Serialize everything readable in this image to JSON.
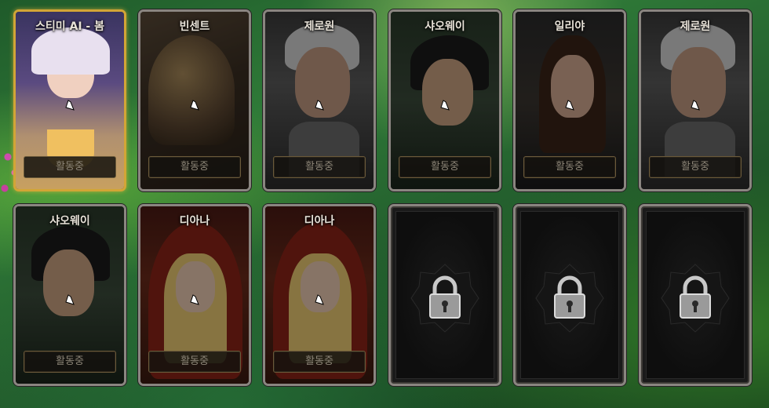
{
  "cards": [
    {
      "name": "스티미 AI - 봄",
      "status": "활동중",
      "locked": false,
      "selected": true
    },
    {
      "name": "빈센트",
      "status": "활동중",
      "locked": false,
      "selected": false
    },
    {
      "name": "제로원",
      "status": "활동중",
      "locked": false,
      "selected": false
    },
    {
      "name": "샤오웨이",
      "status": "활동중",
      "locked": false,
      "selected": false
    },
    {
      "name": "일리야",
      "status": "활동중",
      "locked": false,
      "selected": false
    },
    {
      "name": "제로원",
      "status": "활동중",
      "locked": false,
      "selected": false
    },
    {
      "name": "샤오웨이",
      "status": "활동중",
      "locked": false,
      "selected": false
    },
    {
      "name": "디아나",
      "status": "활동중",
      "locked": false,
      "selected": false
    },
    {
      "name": "디아나",
      "status": "활동중",
      "locked": false,
      "selected": false
    },
    {
      "name": "",
      "status": "",
      "locked": true,
      "selected": false
    },
    {
      "name": "",
      "status": "",
      "locked": true,
      "selected": false
    },
    {
      "name": "",
      "status": "",
      "locked": true,
      "selected": false
    }
  ],
  "colors": {
    "selected_border": "#d2a536",
    "card_border": "#8a8580",
    "status_text": "#8c8577"
  },
  "icons": {
    "cursor": "hand-cursor-icon",
    "lock": "padlock-icon"
  }
}
